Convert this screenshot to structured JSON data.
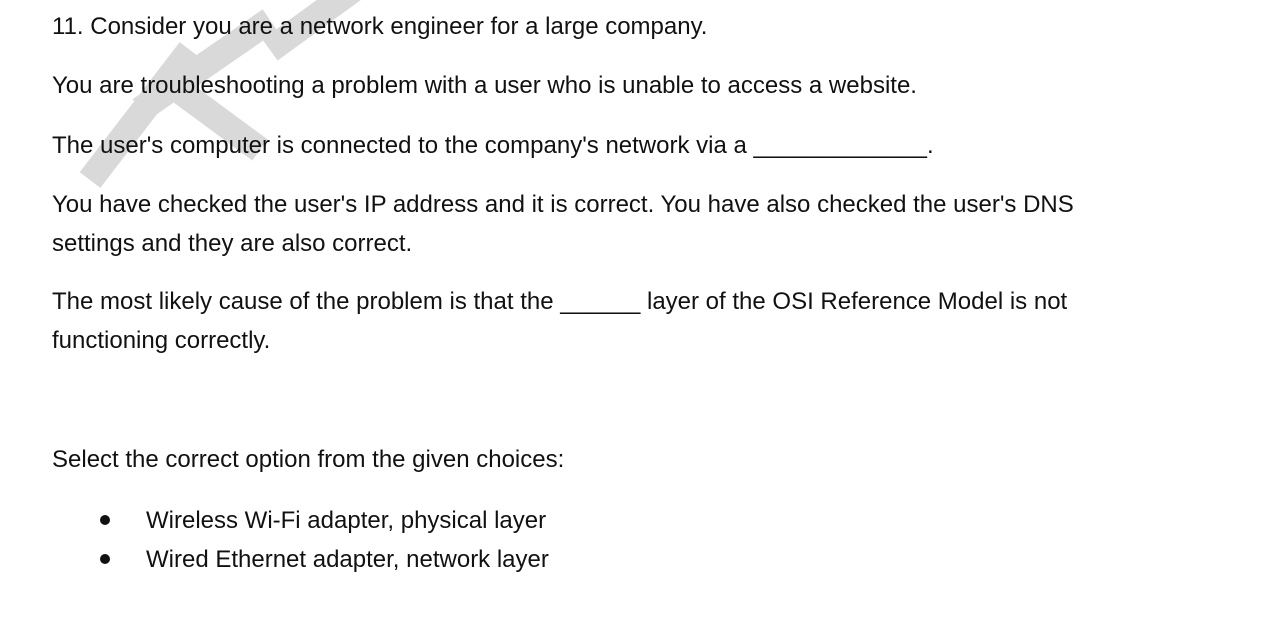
{
  "question": {
    "title": "11. Consider you are a network engineer for a large company.",
    "p1": "You are troubleshooting a problem with a user who is unable to access a website.",
    "p2": "The user's computer is connected to the company's network via a _____________.",
    "p3a": "You have checked the user's IP address and it is correct.  You have also checked the user's DNS",
    "p3b": "settings and they are also correct.",
    "p4a": "The most likely cause of the problem is that the ______ layer of the OSI Reference Model is not",
    "p4b": "functioning correctly.",
    "prompt": "Select the correct option from the given choices:",
    "choices": [
      "Wireless Wi-Fi adapter, physical layer",
      "Wired Ethernet adapter, network layer"
    ]
  },
  "colors": {
    "text": "#111111",
    "watermark": "#d9d9d9"
  },
  "watermark": {
    "icon": "watermark-logo-icon"
  }
}
